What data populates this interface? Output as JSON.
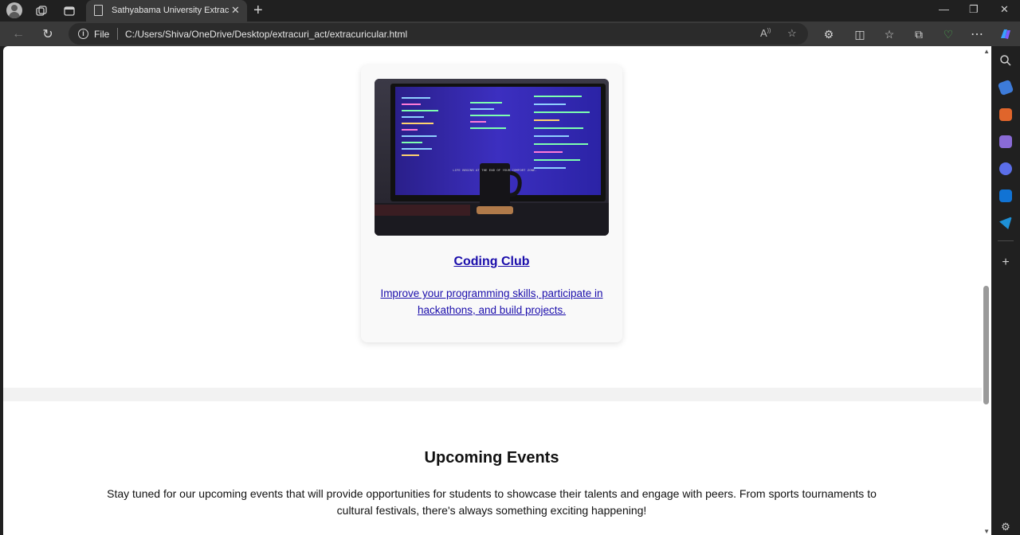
{
  "browser": {
    "tab_title": "Sathyabama University Extracurri",
    "file_label": "File",
    "url": "C:/Users/Shiva/OneDrive/Desktop/extracuri_act/extracuricular.html"
  },
  "card": {
    "title": "Coding Club",
    "description": "Improve your programming skills, participate in hackathons, and build projects."
  },
  "events": {
    "title": "Upcoming Events",
    "text": "Stay tuned for our upcoming events that will provide opportunities for students to showcase their talents and engage with peers. From sports tournaments to cultural festivals, there's always something exciting happening!"
  },
  "mug_text": "LIFE BEGINS AT THE END OF YOUR COMFORT ZONE."
}
